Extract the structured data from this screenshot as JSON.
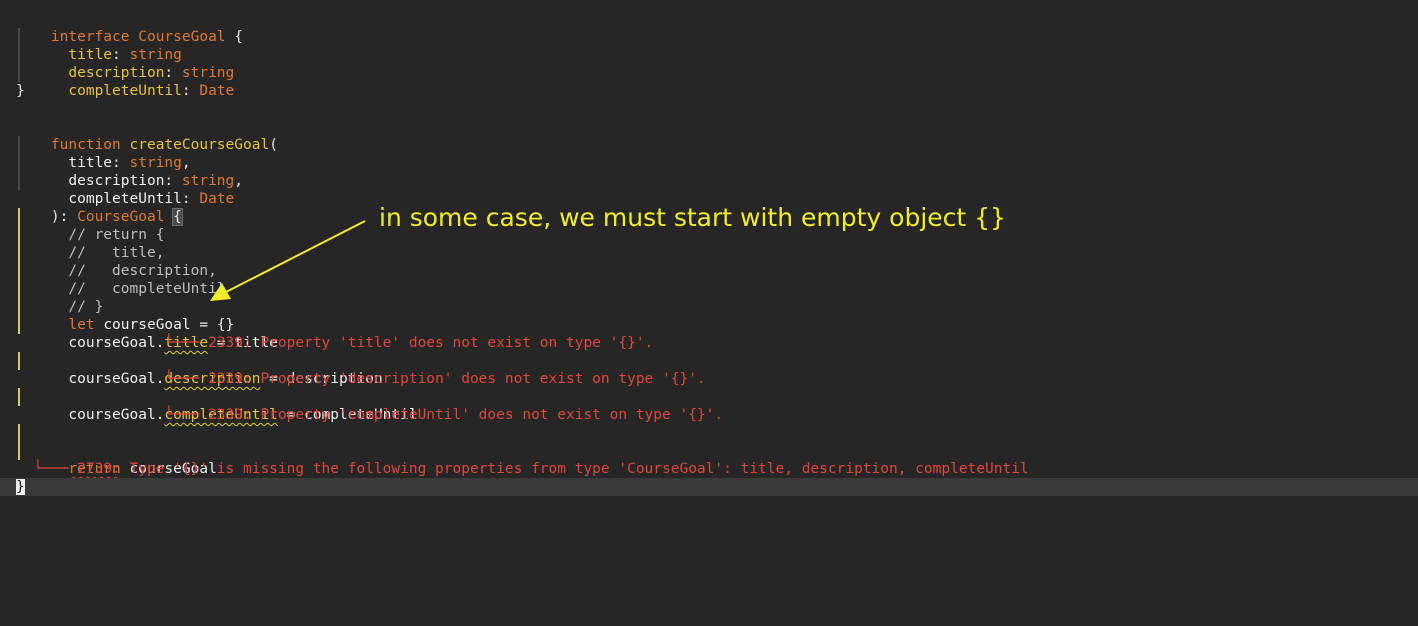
{
  "colors": {
    "background": "#262626",
    "keyword": "#e0782c",
    "property": "#e6c33c",
    "error": "#e0453c",
    "annotation": "#f0ee2a"
  },
  "code": {
    "l1": {
      "kw": "interface",
      "name": "CourseGoal",
      "open": "{"
    },
    "l2": {
      "prop": "title",
      "sep": ":",
      "type": "string"
    },
    "l3": {
      "prop": "description",
      "sep": ":",
      "type": "string"
    },
    "l4": {
      "prop": "completeUntil",
      "sep": ":",
      "type": "Date"
    },
    "l5": {
      "close": "}"
    },
    "l7": {
      "kw": "function",
      "name": "createCourseGoal",
      "open": "("
    },
    "l8": {
      "prop": "title",
      "sep": ":",
      "type": "string",
      "comma": ","
    },
    "l9": {
      "prop": "description",
      "sep": ":",
      "type": "string",
      "comma": ","
    },
    "l10": {
      "prop": "completeUntil",
      "sep": ":",
      "type": "Date"
    },
    "l11": {
      "pre": "):",
      "type": "CourseGoal",
      "brace": "{"
    },
    "l12": {
      "comment": "// return {"
    },
    "l13": {
      "comment": "//   title,"
    },
    "l14": {
      "comment": "//   description,"
    },
    "l15": {
      "comment": "//   completeUntil"
    },
    "l16": {
      "comment": "// }"
    },
    "l17": {
      "kw": "let",
      "rest": "courseGoal = {}"
    },
    "l18": {
      "obj": "courseGoal.",
      "prop": "title",
      "rest": " = title"
    },
    "l18err": {
      "tree": "└───",
      "msg": "2339: Property 'title' does not exist on type '{}'."
    },
    "l19": {
      "obj": "courseGoal.",
      "prop": "description",
      "rest": " = description"
    },
    "l19err": {
      "tree": "└───",
      "msg": "2339: Property 'description' does not exist on type '{}'."
    },
    "l20": {
      "obj": "courseGoal.",
      "prop": "completeUntil",
      "rest": " = completeUntil"
    },
    "l20err": {
      "tree": "└───",
      "msg": "2339: Property 'completeUntil' does not exist on type '{}'."
    },
    "l22": {
      "kw": "return",
      "rest": "courseGoal"
    },
    "l22err": {
      "tree": "└───",
      "msg": "2739: Type '{}' is missing the following properties from type 'CourseGoal': title, description, completeUntil"
    },
    "l23": {
      "close": "}"
    }
  },
  "annotation": {
    "text": "in some case, we must start with empty object {}"
  }
}
